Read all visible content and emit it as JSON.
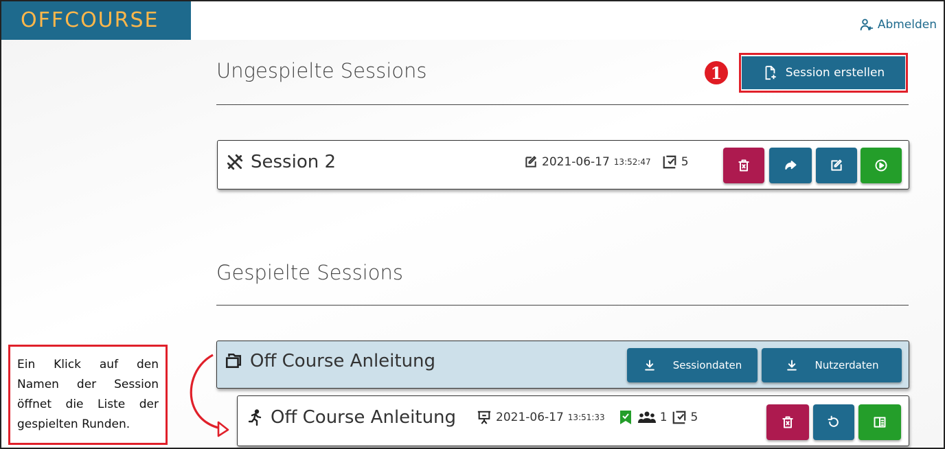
{
  "header": {
    "logo": "OFFCOURSE",
    "logout_label": "Abmelden"
  },
  "unplayed": {
    "title": "Ungespielte Sessions",
    "create_button": "Session erstellen",
    "marker": "1",
    "sessions": [
      {
        "name": "Session 2",
        "edited_date": "2021-06-17",
        "edited_time": "13:52:47",
        "tasks": "5"
      }
    ]
  },
  "played": {
    "title": "Gespielte Sessions",
    "group": {
      "name": "Off Course Anleitung",
      "download_session_label": "Sessiondaten",
      "download_user_label": "Nutzerdaten"
    },
    "runs": [
      {
        "name": "Off Course Anleitung",
        "played_date": "2021-06-17",
        "played_time": "13:51:33",
        "players": "1",
        "tasks": "5"
      }
    ]
  },
  "callout": {
    "text": "Ein Klick auf den Namen der Session öffnet die Liste der gespielten Runden."
  },
  "colors": {
    "primary": "#1f6a8e",
    "danger": "#ad1a4f",
    "success": "#249e2a",
    "logo_text": "#ffb74a",
    "annotation": "#e0202a"
  }
}
